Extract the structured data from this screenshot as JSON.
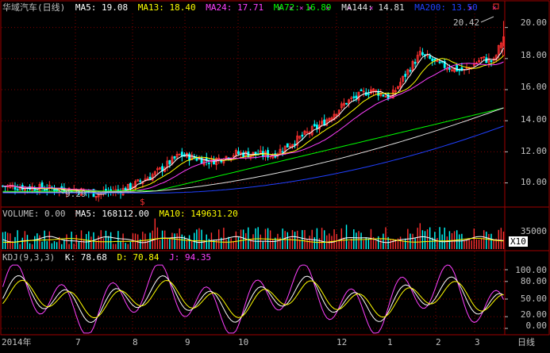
{
  "header": {
    "stock_name": "华域汽车(日线)",
    "ma": [
      {
        "label": "MA5: 19.08",
        "color": "#ffffff"
      },
      {
        "label": "MA13: 18.40",
        "color": "#ffff00"
      },
      {
        "label": "MA24: 17.71",
        "color": "#ff40ff"
      },
      {
        "label": "MA72: 16.89",
        "color": "#00ff00"
      },
      {
        "label": "MA144: 14.81",
        "color": "#e0e0e0"
      },
      {
        "label": "MA200: 13.50",
        "color": "#2040ff"
      }
    ]
  },
  "price_axis": {
    "ticks": [
      "20.00",
      "18.00",
      "16.00",
      "14.00",
      "12.00",
      "10.00"
    ],
    "min": 8.6,
    "max": 20.9
  },
  "annotations": {
    "high_label": "20.42",
    "low_label": "9.29"
  },
  "volume": {
    "header": [
      {
        "label": "VOLUME: 0.00",
        "color": "#c0c0c0"
      },
      {
        "label": "MA5: 168112.00",
        "color": "#ffffff"
      },
      {
        "label": "MA10: 149631.20",
        "color": "#ffff00"
      }
    ],
    "scale_label": "35000",
    "unit_label": "X10"
  },
  "kdj": {
    "header": [
      {
        "label": "KDJ(9,3,3)",
        "color": "#c0c0c0"
      },
      {
        "label": "K: 78.68",
        "color": "#ffffff"
      },
      {
        "label": "D: 70.84",
        "color": "#ffff00"
      },
      {
        "label": "J: 94.35",
        "color": "#ff40ff"
      }
    ],
    "ticks": [
      "100.00",
      "80.00",
      "50.00",
      "20.00",
      "0.00"
    ]
  },
  "time_axis": {
    "labels": [
      "2014年",
      "7",
      "8",
      "9",
      "10",
      "12",
      "1",
      "2",
      "3"
    ],
    "period": "日线"
  },
  "colors": {
    "up": "#ff3030",
    "down": "#00ffff",
    "grid": "#800000",
    "frame": "#a00000"
  },
  "chart_data": {
    "type": "candlestick",
    "series": [
      {
        "name": "MA5",
        "values": [
          19.08
        ]
      },
      {
        "name": "MA13",
        "values": [
          18.4
        ]
      },
      {
        "name": "MA24",
        "values": [
          17.71
        ]
      },
      {
        "name": "MA72",
        "values": [
          16.89
        ]
      },
      {
        "name": "MA144",
        "values": [
          14.81
        ]
      },
      {
        "name": "MA200",
        "values": [
          13.5
        ]
      }
    ],
    "high": 20.42,
    "low": 9.29,
    "ylim": [
      8.6,
      20.9
    ]
  }
}
